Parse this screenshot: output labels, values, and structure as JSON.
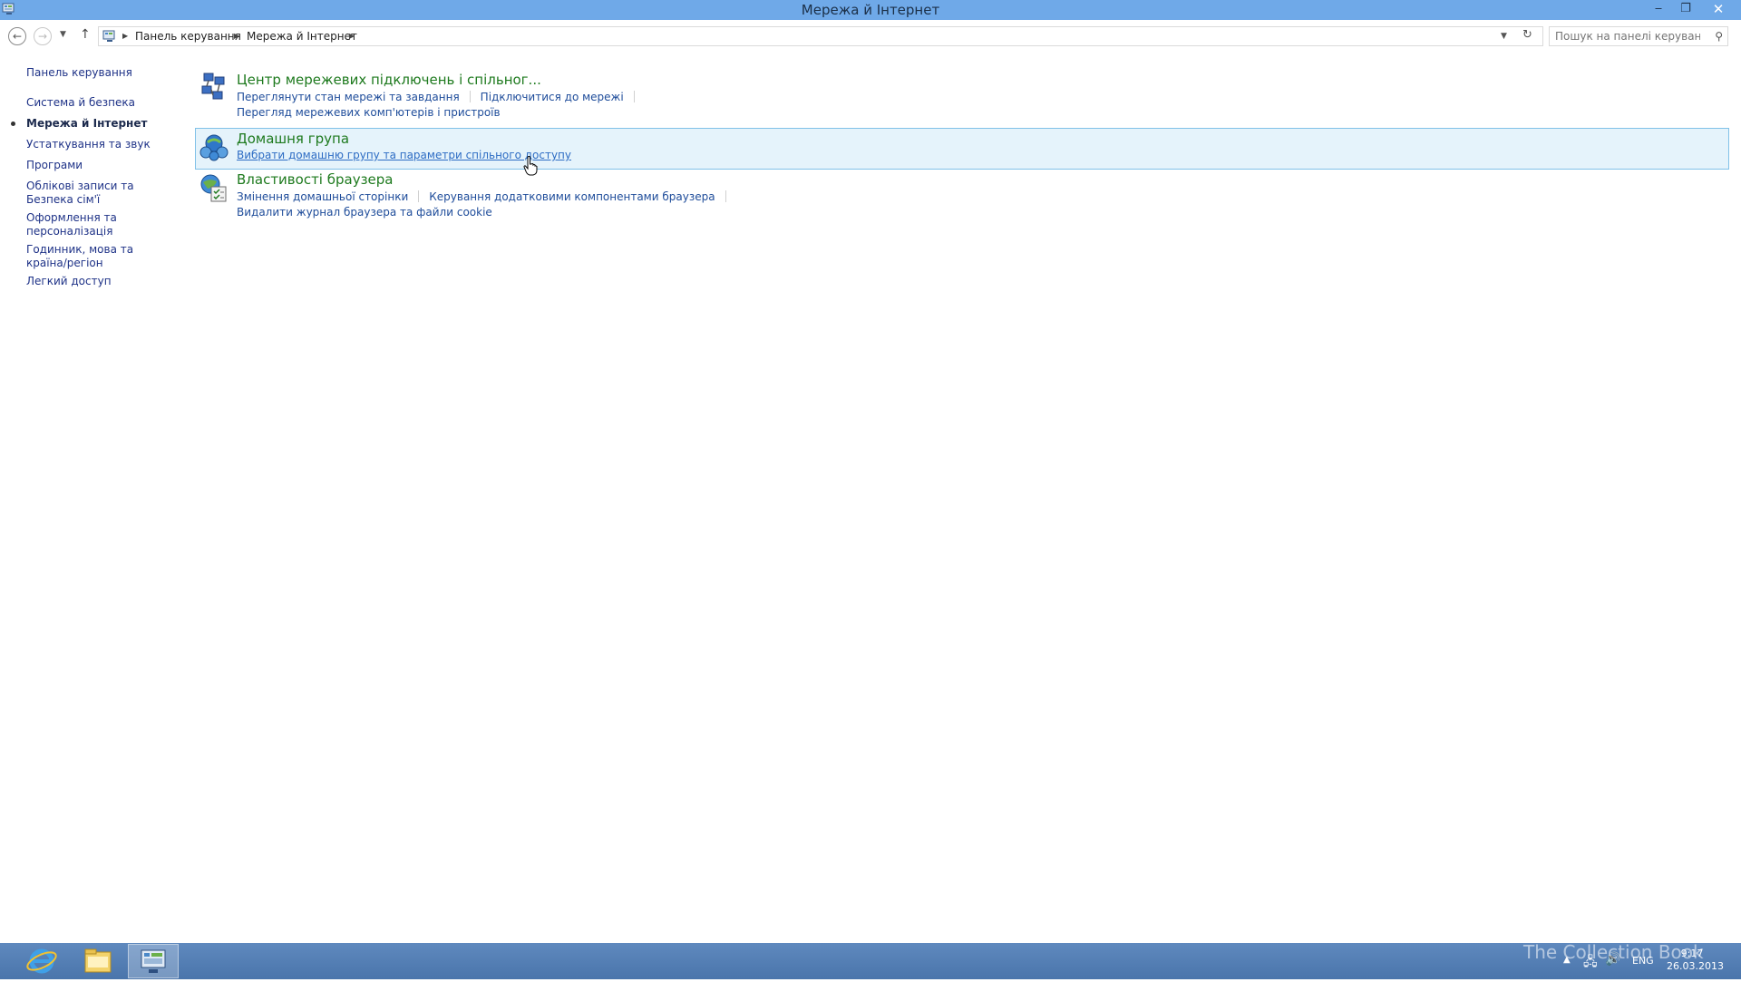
{
  "window": {
    "title": "Мережа й Інтернет",
    "controls": {
      "minimize": "‒",
      "maximize": "❐",
      "close": "✕"
    }
  },
  "address": {
    "breadcrumbs": [
      "Панель керування",
      "Мережа й Інтернет"
    ],
    "search_placeholder": "Пошук на панелі керування"
  },
  "sidebar": {
    "home": "Панель керування",
    "items": [
      "Система й безпека",
      "Мережа й Інтернет",
      "Устаткування та звук",
      "Програми",
      "Облікові записи та Безпека сім'ї",
      "Оформлення та персоналізація",
      "Годинник, мова та країна/регіон",
      "Легкий доступ"
    ],
    "current_index": 1
  },
  "categories": [
    {
      "title": "Центр мережевих підключень і спільног...",
      "links_row1": [
        "Переглянути стан мережі та завдання",
        "Підключитися до мережі"
      ],
      "links_row2": [
        "Перегляд мережевих комп'ютерів і пристроїв"
      ],
      "icon": "network-center-icon"
    },
    {
      "title": "Домашня група",
      "links_row1": [
        "Вибрати домашню групу та параметри спільного доступу"
      ],
      "icon": "homegroup-icon",
      "hovered": true
    },
    {
      "title": "Властивості браузера",
      "links_row1": [
        "Змінення домашньої сторінки",
        "Керування додатковими компонентами браузера"
      ],
      "links_row2": [
        "Видалити журнал браузера та файли cookie"
      ],
      "icon": "browser-properties-icon"
    }
  ],
  "taskbar": {
    "apps": [
      "internet-explorer-icon",
      "file-explorer-icon",
      "control-panel-icon"
    ],
    "active_index": 2,
    "language": "ENG",
    "time": "9:17",
    "date": "26.03.2013"
  },
  "watermark": "The Collection Book"
}
